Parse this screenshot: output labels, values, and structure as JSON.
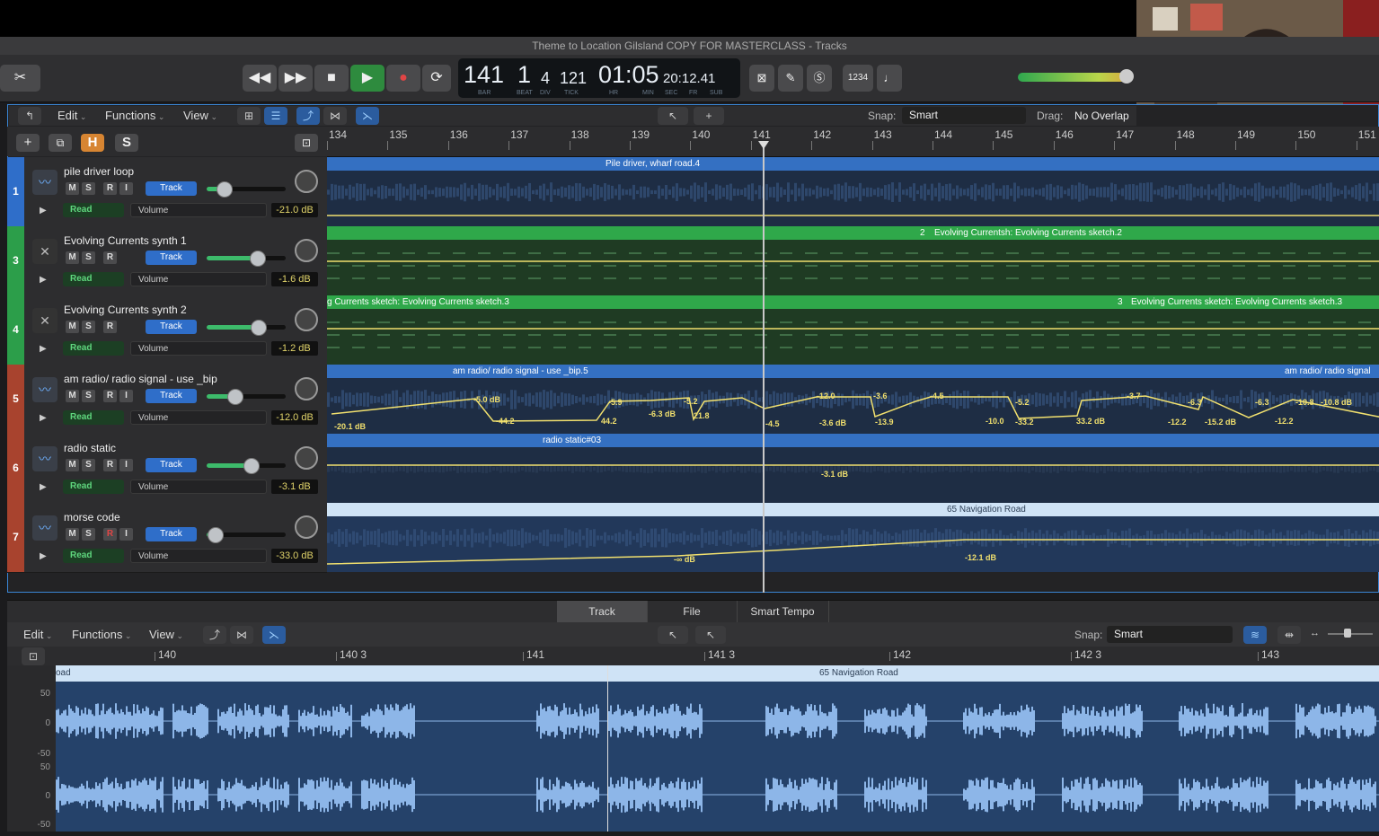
{
  "window": {
    "title": "Theme to Location Gilsland COPY FOR MASTERCLASS - Tracks"
  },
  "lcd": {
    "bar": "141",
    "beat": "1",
    "div": "4",
    "tick": "121",
    "time": "01:05",
    "time_small": "20:12.41",
    "labels": {
      "bar": "BAR",
      "beat": "BEAT",
      "div": "DIV",
      "tick": "TICK",
      "hr": "HR",
      "min": "MIN",
      "sec": "SEC",
      "fr": "FR",
      "sub": "SUB"
    }
  },
  "transport": {
    "counter_label": "1234"
  },
  "main_toolbar": {
    "edit": "Edit",
    "functions": "Functions",
    "view": "View",
    "snap_label": "Snap:",
    "snap_value": "Smart",
    "drag_label": "Drag:",
    "drag_value": "No Overlap"
  },
  "ruler": {
    "bars": [
      "134",
      "135",
      "136",
      "137",
      "138",
      "139",
      "140",
      "141",
      "142",
      "143",
      "144",
      "145",
      "146",
      "147",
      "148",
      "149",
      "150",
      "151"
    ]
  },
  "header_buttons": {
    "add": "+",
    "h": "H",
    "s": "S"
  },
  "tracks": [
    {
      "num": "1",
      "name": "pile driver loop",
      "m": "M",
      "s": "S",
      "r": "R",
      "i": "I",
      "track_btn": "Track",
      "read": "Read",
      "param": "Volume",
      "db": "-21.0 dB",
      "color": "#2f6ec9",
      "fader": 0.22,
      "region": "Pile driver, wharf road.4"
    },
    {
      "num": "3",
      "name": "Evolving Currents synth 1",
      "m": "M",
      "s": "S",
      "r": "R",
      "track_btn": "Track",
      "read": "Read",
      "param": "Volume",
      "db": "-1.6 dB",
      "color": "#2c9e4a",
      "fader": 0.64,
      "region": "Evolving Currentsh: Evolving Currents sketch.2",
      "region_num": "2"
    },
    {
      "num": "4",
      "name": "Evolving Currents synth 2",
      "m": "M",
      "s": "S",
      "r": "R",
      "track_btn": "Track",
      "read": "Read",
      "param": "Volume",
      "db": "-1.2 dB",
      "color": "#2c9e4a",
      "fader": 0.65,
      "region": "g Currents sketch: Evolving Currents sketch.3",
      "region2": "Evolving Currents sketch: Evolving Currents sketch.3",
      "region_num": "3"
    },
    {
      "num": "5",
      "name": "am radio/ radio signal - use _bip",
      "m": "M",
      "s": "S",
      "r": "R",
      "i": "I",
      "track_btn": "Track",
      "read": "Read",
      "param": "Volume",
      "db": "-12.0 dB",
      "color": "#a8432e",
      "fader": 0.35,
      "region": "am radio/ radio signal - use _bip.5",
      "region2": "am radio/ radio signal"
    },
    {
      "num": "6",
      "name": "radio static",
      "m": "M",
      "s": "S",
      "r": "R",
      "i": "I",
      "track_btn": "Track",
      "read": "Read",
      "param": "Volume",
      "db": "-3.1 dB",
      "color": "#a8432e",
      "fader": 0.56,
      "region": "radio static#03"
    },
    {
      "num": "7",
      "name": "morse code",
      "m": "M",
      "s": "S",
      "r": "R",
      "i": "I",
      "track_btn": "Track",
      "read": "Read",
      "param": "Volume",
      "db": "-33.0 dB",
      "color": "#a8432e",
      "fader": 0.1,
      "region": "65 Navigation Road"
    }
  ],
  "automation": {
    "radio_points": [
      "-20.1 dB",
      "-5.0 dB",
      "-44.2",
      "44.2",
      "-5.9",
      "-6.3 dB",
      "-5.2",
      "21.8",
      "-4.5",
      "-12.0",
      "-3.6 dB",
      "-3.6",
      "-13.9",
      "-4.5",
      "-10.0",
      "-5.2",
      "-33.2",
      "33.2 dB",
      "-3.7",
      "-12.2",
      "-6.3",
      "-15.2 dB",
      "-6.3",
      "-12.2",
      "-10.8",
      "-10.8 dB"
    ],
    "static_point": "-3.1 dB",
    "morse_points": [
      "-∞ dB",
      "-12.1 dB"
    ]
  },
  "bottom_tabs": {
    "track": "Track",
    "file": "File",
    "smart_tempo": "Smart Tempo"
  },
  "bottom_toolbar": {
    "edit": "Edit",
    "functions": "Functions",
    "view": "View",
    "snap_label": "Snap:",
    "snap_value": "Smart"
  },
  "bottom_ruler": {
    "marks": [
      "140",
      "140 3",
      "141",
      "141 3",
      "142",
      "142 3",
      "143"
    ]
  },
  "bottom_region": {
    "left": "oad",
    "title": "65 Navigation Road"
  },
  "wave_scale": [
    "50",
    "0",
    "-50",
    "50",
    "0",
    "-50"
  ],
  "colors": {
    "accent": "#2f6ec9",
    "green": "#2c9e4a",
    "automation": "#f1e06e",
    "play": "#2e8b3e",
    "record": "#d83a3a"
  }
}
